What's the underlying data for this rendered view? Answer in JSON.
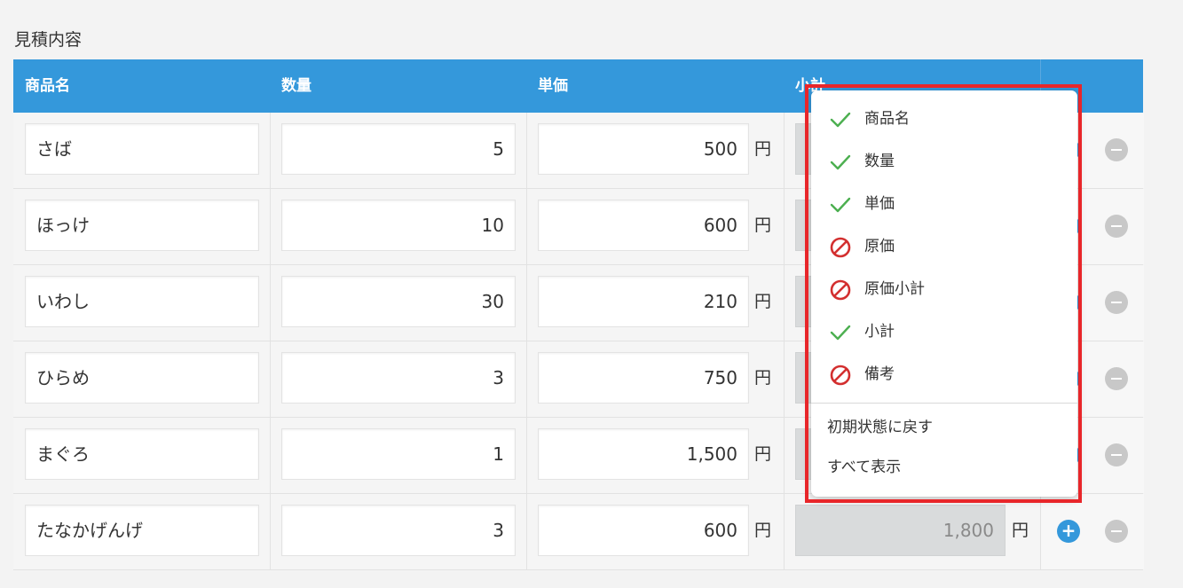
{
  "section_title": "見積内容",
  "headers": {
    "product": "商品名",
    "quantity": "数量",
    "unit_price": "単価",
    "subtotal": "小計"
  },
  "currency_unit": "円",
  "rows": [
    {
      "product": "さば",
      "quantity": "5",
      "unit_price": "500",
      "subtotal": ""
    },
    {
      "product": "ほっけ",
      "quantity": "10",
      "unit_price": "600",
      "subtotal": ""
    },
    {
      "product": "いわし",
      "quantity": "30",
      "unit_price": "210",
      "subtotal": ""
    },
    {
      "product": "ひらめ",
      "quantity": "3",
      "unit_price": "750",
      "subtotal": ""
    },
    {
      "product": "まぐろ",
      "quantity": "1",
      "unit_price": "1,500",
      "subtotal": ""
    },
    {
      "product": "たなかげんげ",
      "quantity": "3",
      "unit_price": "600",
      "subtotal": "1,800"
    }
  ],
  "row_actions": {
    "add_symbol": "+"
  },
  "column_menu": {
    "items": [
      {
        "label": "商品名",
        "state": "visible",
        "icon": "check-icon"
      },
      {
        "label": "数量",
        "state": "visible",
        "icon": "check-icon"
      },
      {
        "label": "単価",
        "state": "visible",
        "icon": "check-icon"
      },
      {
        "label": "原価",
        "state": "hidden",
        "icon": "prohibited-icon"
      },
      {
        "label": "原価小計",
        "state": "hidden",
        "icon": "prohibited-icon"
      },
      {
        "label": "小計",
        "state": "visible",
        "icon": "check-icon"
      },
      {
        "label": "備考",
        "state": "hidden",
        "icon": "prohibited-icon"
      }
    ],
    "reset_label": "初期状態に戻す",
    "show_all_label": "すべて表示"
  },
  "colors": {
    "header_bg": "#3498db",
    "check": "#4caf50",
    "prohibited": "#d32f2f",
    "highlight": "#e8262a"
  }
}
